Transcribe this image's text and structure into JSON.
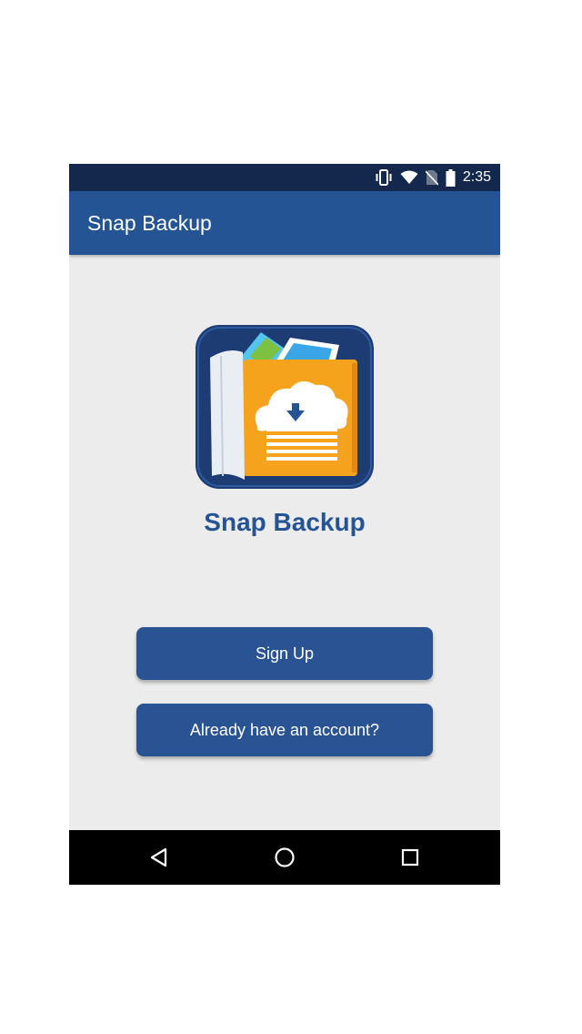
{
  "status_bar": {
    "time": "2:35",
    "icons": [
      "vibrate-icon",
      "wifi-icon",
      "no-sim-icon",
      "battery-icon"
    ]
  },
  "app_bar": {
    "title": "Snap Backup"
  },
  "main": {
    "logo_icon": "snap-backup-logo-icon",
    "app_name": "Snap Backup",
    "signup_label": "Sign Up",
    "login_label": "Already have an account?"
  },
  "nav_bar": {
    "icons": [
      "back-icon",
      "home-icon",
      "recents-icon"
    ]
  },
  "colors": {
    "status_bar": "#13284c",
    "primary": "#255494",
    "button": "#2a5393",
    "background": "#ececec",
    "logo_orange": "#f5a21d"
  }
}
